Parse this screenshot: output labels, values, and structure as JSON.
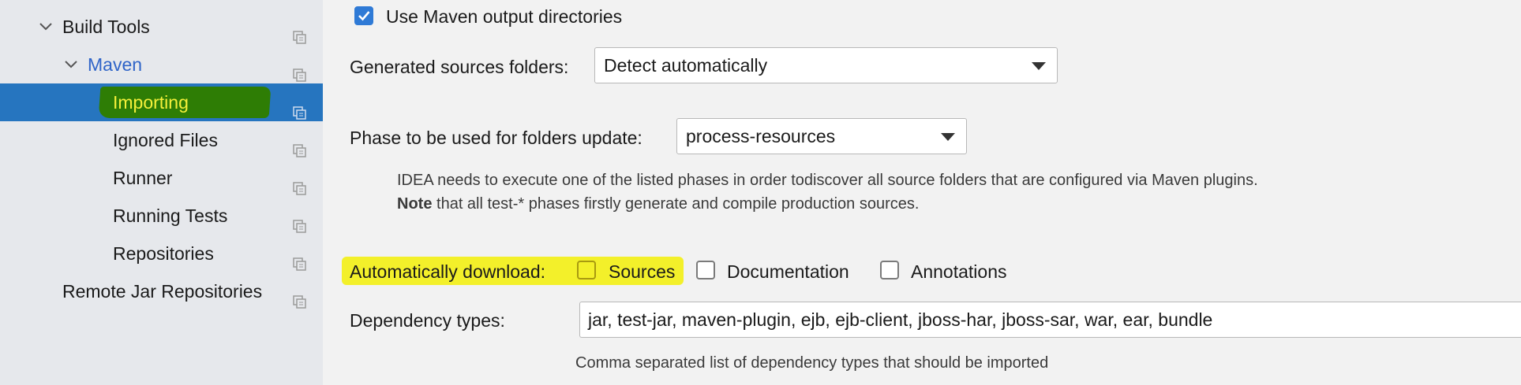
{
  "sidebar": {
    "items": [
      {
        "label": "Build Tools"
      },
      {
        "label": "Maven"
      },
      {
        "label": "Importing"
      },
      {
        "label": "Ignored Files"
      },
      {
        "label": "Runner"
      },
      {
        "label": "Running Tests"
      },
      {
        "label": "Repositories"
      },
      {
        "label": "Remote Jar Repositories"
      }
    ],
    "selected": "Importing",
    "selected_color": "#2675bf",
    "highlight_color": "#2e7d05"
  },
  "settings": {
    "use_output_dirs": {
      "label": "Use Maven output directories",
      "checked": true
    },
    "generated_sources": {
      "label": "Generated sources folders:",
      "value": "Detect automatically"
    },
    "phase": {
      "label": "Phase to be used for folders update:",
      "value": "process-resources"
    },
    "phase_help": {
      "line1": "IDEA needs to execute one of the listed phases in order todiscover all source folders that are configured via Maven plugins.",
      "note_bold": "Note",
      "note_rest": " that all test-* phases firstly generate and compile production sources."
    },
    "auto_download": {
      "label": "Automatically download:",
      "options": [
        {
          "label": "Sources",
          "checked": false
        },
        {
          "label": "Documentation",
          "checked": false
        },
        {
          "label": "Annotations",
          "checked": false
        }
      ],
      "highlight_color": "#f3f02a"
    },
    "dependency_types": {
      "label": "Dependency types:",
      "value": "jar, test-jar, maven-plugin, ejb, ejb-client, jboss-har, jboss-sar, war, ear, bundle",
      "help": "Comma separated list of dependency types that should be imported"
    }
  },
  "icons": {
    "chevron": "chevron-down-icon",
    "copy": "copy-settings-icon",
    "check": "check-icon"
  },
  "colors": {
    "link": "#2f64c8",
    "checkbox_checked": "#2f7ad6"
  }
}
